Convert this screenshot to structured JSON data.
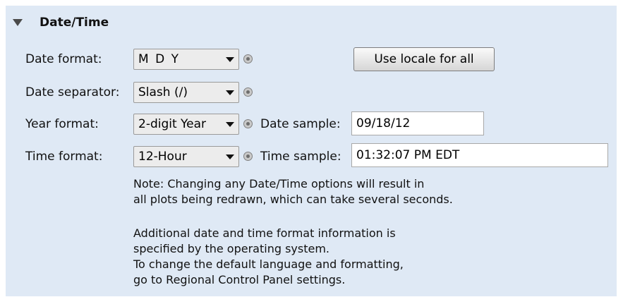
{
  "section": {
    "title": "Date/Time"
  },
  "date_format": {
    "label": "Date format:",
    "value": "M D Y"
  },
  "locale_button": {
    "label": "Use locale for all"
  },
  "date_separator": {
    "label": "Date separator:",
    "value": "Slash (/)"
  },
  "year_format": {
    "label": "Year format:",
    "value": "2-digit Year"
  },
  "date_sample": {
    "label": "Date sample:",
    "value": "09/18/12"
  },
  "time_format": {
    "label": "Time format:",
    "value": "12-Hour"
  },
  "time_sample": {
    "label": "Time sample:",
    "value": "01:32:07 PM EDT"
  },
  "notes": {
    "line1": "Note: Changing any Date/Time options will result in",
    "line2": "all plots being redrawn, which can take several seconds.",
    "line3": "Additional date and time format information is",
    "line4": "specified by the operating system.",
    "line5": "To change the default language and formatting,",
    "line6": "go to Regional Control Panel settings."
  },
  "icons": {
    "collapse": "triangle-down-icon",
    "help": "help-icon"
  }
}
